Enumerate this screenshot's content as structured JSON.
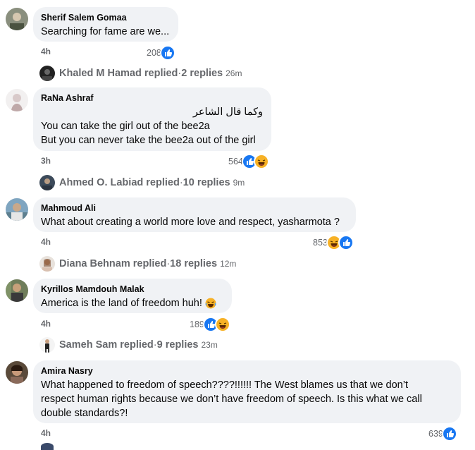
{
  "colors": {
    "bubble": "#f0f2f5",
    "like": "#1877f2",
    "haha": "#f7b125",
    "secondary_text": "#65676b"
  },
  "comments": [
    {
      "author": "Sherif Salem Gomaa",
      "lines": [
        "Searching for fame are we..."
      ],
      "time": "4h",
      "reaction_count": "208",
      "reactions": [
        "like-icon"
      ],
      "replies": {
        "replier": "Khaled M Hamad",
        "label": "replied",
        "sep": " · ",
        "count": "2 replies",
        "time": "26m"
      }
    },
    {
      "author": "RaNa Ashraf",
      "rtl_line": "وكما قال الشاعر",
      "lines": [
        "You can take the girl out of the bee2a",
        "But you can never take the bee2a out of the girl"
      ],
      "time": "3h",
      "reaction_count": "564",
      "reactions": [
        "like-icon",
        "haha-icon"
      ],
      "replies": {
        "replier": "Ahmed O. Labiad",
        "label": "replied",
        "sep": " · ",
        "count": "10 replies",
        "time": "9m"
      }
    },
    {
      "author": "Mahmoud Ali",
      "lines": [
        "What about creating a world more love and respect, yasharmota ?"
      ],
      "time": "4h",
      "reaction_count": "853",
      "reactions": [
        "haha-icon",
        "like-icon"
      ],
      "replies": {
        "replier": "Diana Behnam",
        "label": "replied",
        "sep": " · ",
        "count": "18 replies",
        "time": "12m"
      }
    },
    {
      "author": "Kyrillos Mamdouh Malak",
      "lines": [
        "America is the land of freedom huh!"
      ],
      "time": "4h",
      "reaction_count": "189",
      "reactions": [
        "like-icon",
        "haha-icon"
      ],
      "replies": {
        "replier": "Sameh Sam",
        "label": "replied",
        "sep": " · ",
        "count": "9 replies",
        "time": "23m"
      }
    },
    {
      "author": "Amira Nasry",
      "lines": [
        "What happened to freedom of speech????!!!!!! The West blames us that we don’t",
        "respect human rights because we don’t have freedom of speech. Is this what we call",
        "double standards?!"
      ],
      "time": "4h",
      "reaction_count": "639",
      "reactions": [
        "like-icon"
      ]
    }
  ]
}
